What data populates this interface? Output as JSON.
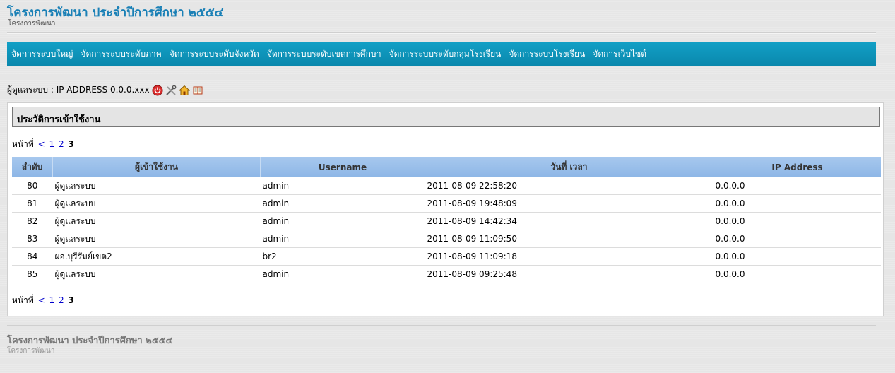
{
  "header": {
    "title": "โครงการพัฒนา ประจำปีการศึกษา ๒๕๕๔",
    "subtitle": "โครงการพัฒนา"
  },
  "nav": {
    "items": [
      "จัดการระบบใหญ่",
      "จัดการระบบระดับภาค",
      "จัดการระบบระดับจังหวัด",
      "จัดการระบบระดับเขตการศึกษา",
      "จัดการระบบระดับกลุ่มโรงเรียน",
      "จัดการระบบโรงเรียน",
      "จัดการเว็บไซต์"
    ]
  },
  "admin": {
    "text": "ผู้ดูแลระบบ : IP ADDRESS 0.0.0.xxx",
    "icons": [
      "power-icon",
      "tools-icon",
      "home-icon",
      "book-icon"
    ]
  },
  "panel": {
    "title": "ประวัติการเข้าใช้งาน"
  },
  "pager": {
    "label": "หน้าที่",
    "prev": "<",
    "pages": [
      "1",
      "2"
    ],
    "current": "3"
  },
  "table": {
    "columns": [
      "ลำดับ",
      "ผู้เข้าใช้งาน",
      "Username",
      "วันที่ เวลา",
      "IP Address"
    ],
    "rows": [
      [
        "80",
        "ผู้ดูแลระบบ",
        "admin",
        "2011-08-09 22:58:20",
        "0.0.0.0"
      ],
      [
        "81",
        "ผู้ดูแลระบบ",
        "admin",
        "2011-08-09 19:48:09",
        "0.0.0.0"
      ],
      [
        "82",
        "ผู้ดูแลระบบ",
        "admin",
        "2011-08-09 14:42:34",
        "0.0.0.0"
      ],
      [
        "83",
        "ผู้ดูแลระบบ",
        "admin",
        "2011-08-09 11:09:50",
        "0.0.0.0"
      ],
      [
        "84",
        "ผอ.บุรีรัมย์เขต2",
        "br2",
        "2011-08-09 11:09:18",
        "0.0.0.0"
      ],
      [
        "85",
        "ผู้ดูแลระบบ",
        "admin",
        "2011-08-09 09:25:48",
        "0.0.0.0"
      ]
    ]
  },
  "footer": {
    "title": "โครงการพัฒนา ประจำปีการศึกษา ๒๕๕๔",
    "subtitle": "โครงการพัฒนา"
  },
  "colors": {
    "accent": "#1a80b6",
    "nav_bg": "#0e95bb",
    "table_header": "#9cc0ea"
  }
}
